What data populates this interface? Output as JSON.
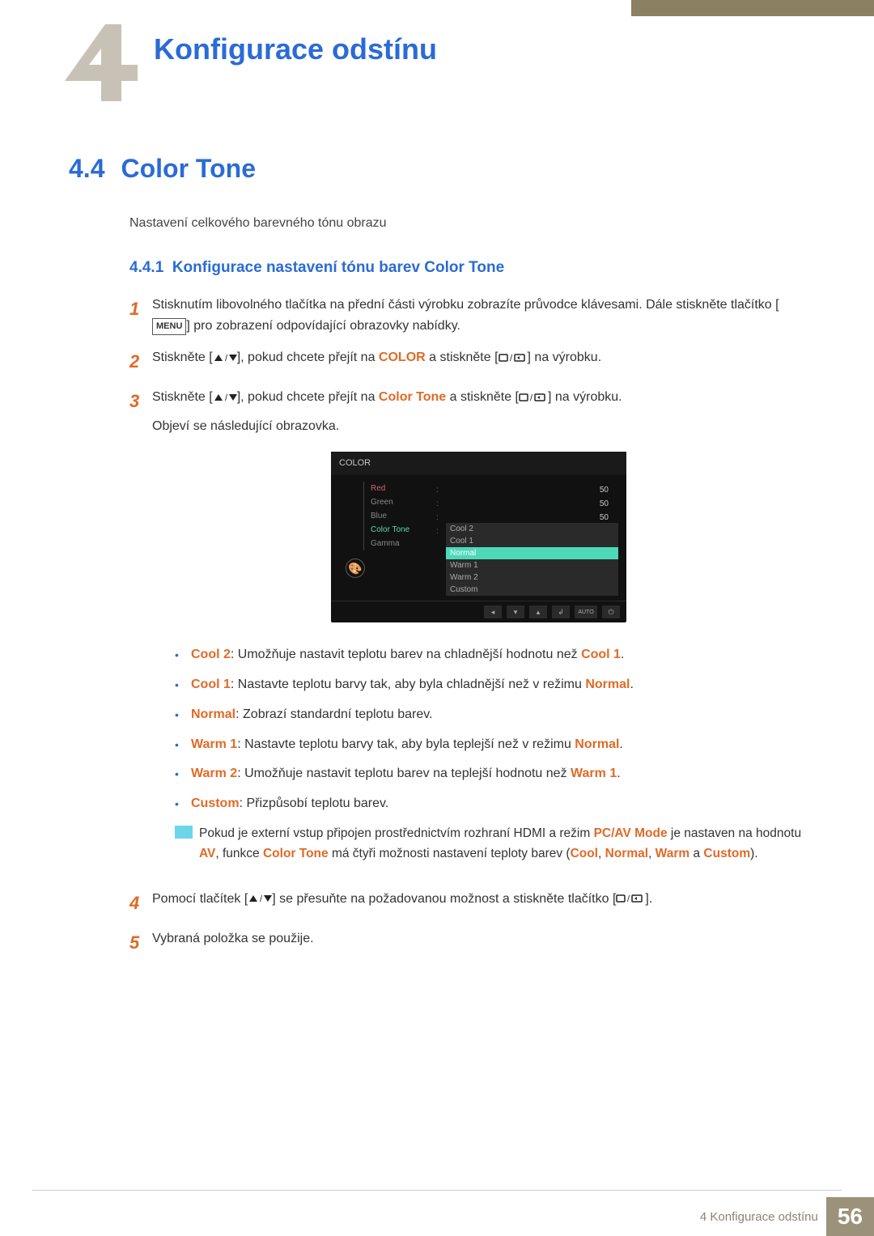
{
  "header": {
    "chapterTitle": "Konfigurace odstínu"
  },
  "section": {
    "number": "4.4",
    "title": "Color Tone",
    "intro": "Nastavení celkového barevného tónu obrazu"
  },
  "subsection": {
    "number": "4.4.1",
    "title": "Konfigurace nastavení tónu barev Color Tone"
  },
  "steps": {
    "s1": {
      "num": "1",
      "pre": "Stisknutím libovolného tlačítka na přední části výrobku zobrazíte průvodce klávesami. Dále stiskněte tlačítko [",
      "menu": "MENU",
      "post": "] pro zobrazení odpovídající obrazovky nabídky."
    },
    "s2": {
      "num": "2",
      "pre": "Stiskněte [",
      "mid1": "], pokud chcete přejít na ",
      "target": "COLOR",
      "mid2": " a stiskněte [",
      "post": "] na výrobku."
    },
    "s3": {
      "num": "3",
      "pre": "Stiskněte [",
      "mid1": "], pokud chcete přejít na ",
      "target": "Color Tone",
      "mid2": " a stiskněte [",
      "post": "] na výrobku.",
      "line2": "Objeví se následující obrazovka."
    },
    "s4": {
      "num": "4",
      "pre": "Pomocí tlačítek [",
      "mid": "] se přesuňte na požadovanou možnost a stiskněte tlačítko [",
      "post": "]."
    },
    "s5": {
      "num": "5",
      "text": "Vybraná položka se použije."
    }
  },
  "osd": {
    "title": "COLOR",
    "menu": {
      "red": "Red",
      "green": "Green",
      "blue": "Blue",
      "colorTone": "Color Tone",
      "gamma": "Gamma"
    },
    "values": {
      "red": "50",
      "green": "50",
      "blue": "50"
    },
    "options": {
      "cool2": "Cool 2",
      "cool1": "Cool 1",
      "normal": "Normal",
      "warm1": "Warm 1",
      "warm2": "Warm 2",
      "custom": "Custom"
    },
    "nav": {
      "auto": "AUTO"
    }
  },
  "bullets": {
    "cool2": {
      "label": "Cool 2",
      "sep": ": Umožňuje nastavit teplotu barev na chladnější hodnotu než ",
      "ref": "Cool 1",
      "end": "."
    },
    "cool1": {
      "label": "Cool 1",
      "sep": ": Nastavte teplotu barvy tak, aby byla chladnější než v režimu ",
      "ref": "Normal",
      "end": "."
    },
    "normal": {
      "label": "Normal",
      "text": ": Zobrazí standardní teplotu barev."
    },
    "warm1": {
      "label": "Warm 1",
      "sep": ": Nastavte teplotu barvy tak, aby byla teplejší než v režimu ",
      "ref": "Normal",
      "end": "."
    },
    "warm2": {
      "label": "Warm 2",
      "sep": ": Umožňuje nastavit teplotu barev na teplejší hodnotu než ",
      "ref": "Warm 1",
      "end": "."
    },
    "custom": {
      "label": "Custom",
      "text": ": Přizpůsobí teplotu barev."
    }
  },
  "note": {
    "pre": "Pokud je externí vstup připojen prostřednictvím rozhraní HDMI a režim ",
    "pcav": "PC/AV Mode",
    "mid1": " je nastaven na hodnotu ",
    "av": "AV",
    "mid2": ", funkce ",
    "ct": "Color Tone",
    "mid3": " má čtyři možnosti nastavení teploty barev (",
    "cool": "Cool",
    "c1": ", ",
    "normal": "Normal",
    "c2": ", ",
    "warm": "Warm",
    "c3": " a ",
    "custom": "Custom",
    "end": ")."
  },
  "footer": {
    "label": "4 Konfigurace odstínu",
    "page": "56"
  }
}
